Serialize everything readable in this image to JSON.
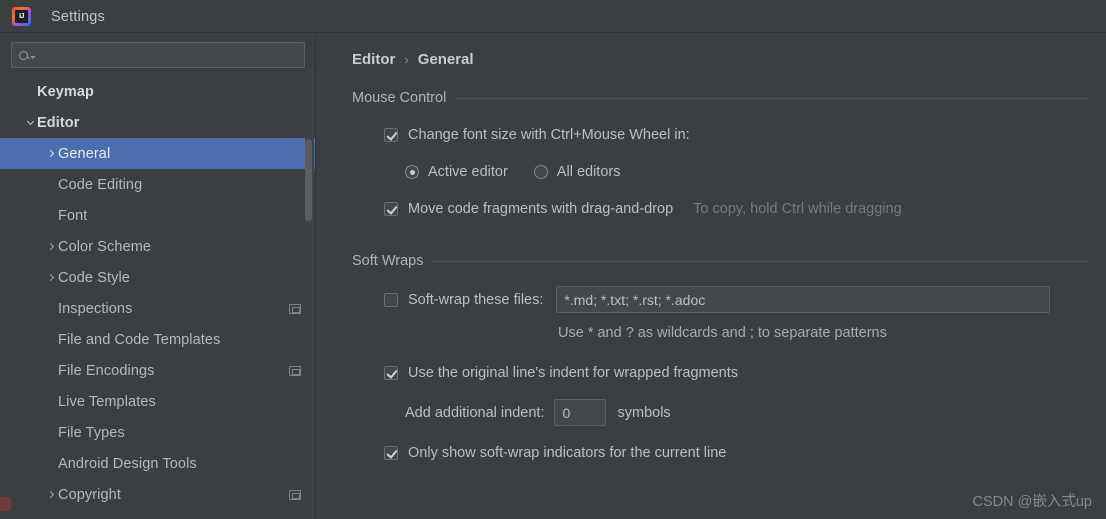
{
  "window": {
    "title": "Settings",
    "logo_icon": "intellij-idea-logo-icon"
  },
  "sidebar": {
    "search": {
      "placeholder": "",
      "value": "",
      "icon": "search-icon",
      "dropdown_icon": "chevron-down-icon"
    },
    "items": [
      {
        "label": "Keymap",
        "level": 0,
        "chevron": "none",
        "bold": true,
        "selected": false,
        "scope_icon": false
      },
      {
        "label": "Editor",
        "level": 0,
        "chevron": "down",
        "bold": true,
        "selected": false,
        "scope_icon": false
      },
      {
        "label": "General",
        "level": 1,
        "chevron": "right",
        "bold": false,
        "selected": true,
        "scope_icon": false
      },
      {
        "label": "Code Editing",
        "level": 1,
        "chevron": "none",
        "bold": false,
        "selected": false,
        "scope_icon": false
      },
      {
        "label": "Font",
        "level": 1,
        "chevron": "none",
        "bold": false,
        "selected": false,
        "scope_icon": false
      },
      {
        "label": "Color Scheme",
        "level": 1,
        "chevron": "right",
        "bold": false,
        "selected": false,
        "scope_icon": false
      },
      {
        "label": "Code Style",
        "level": 1,
        "chevron": "right",
        "bold": false,
        "selected": false,
        "scope_icon": false
      },
      {
        "label": "Inspections",
        "level": 1,
        "chevron": "none",
        "bold": false,
        "selected": false,
        "scope_icon": true
      },
      {
        "label": "File and Code Templates",
        "level": 1,
        "chevron": "none",
        "bold": false,
        "selected": false,
        "scope_icon": false
      },
      {
        "label": "File Encodings",
        "level": 1,
        "chevron": "none",
        "bold": false,
        "selected": false,
        "scope_icon": true
      },
      {
        "label": "Live Templates",
        "level": 1,
        "chevron": "none",
        "bold": false,
        "selected": false,
        "scope_icon": false
      },
      {
        "label": "File Types",
        "level": 1,
        "chevron": "none",
        "bold": false,
        "selected": false,
        "scope_icon": false
      },
      {
        "label": "Android Design Tools",
        "level": 1,
        "chevron": "none",
        "bold": false,
        "selected": false,
        "scope_icon": false
      },
      {
        "label": "Copyright",
        "level": 1,
        "chevron": "right",
        "bold": false,
        "selected": false,
        "scope_icon": true
      }
    ]
  },
  "main": {
    "breadcrumb": {
      "parent": "Editor",
      "separator": "›",
      "current": "General"
    },
    "sections": [
      {
        "title": "Mouse Control",
        "checkbox_font_size": {
          "label": "Change font size with Ctrl+Mouse Wheel in:",
          "checked": true
        },
        "radios": [
          {
            "label": "Active editor",
            "selected": true
          },
          {
            "label": "All editors",
            "selected": false
          }
        ],
        "checkbox_drag_drop": {
          "label": "Move code fragments with drag-and-drop",
          "checked": true,
          "hint": "To copy, hold Ctrl while dragging"
        }
      },
      {
        "title": "Soft Wraps",
        "checkbox_softwrap": {
          "label": "Soft-wrap these files:",
          "checked": false
        },
        "softwrap_files": {
          "value": "*.md; *.txt; *.rst; *.adoc",
          "placeholder": ""
        },
        "wildcard_hint": "Use * and ? as wildcards and ; to separate patterns",
        "checkbox_indent": {
          "label": "Use the original line's indent for wrapped fragments",
          "checked": true
        },
        "additional_indent": {
          "label": "Add additional indent:",
          "value": "0",
          "unit": "symbols"
        },
        "checkbox_indicators": {
          "label": "Only show soft-wrap indicators for the current line",
          "checked": true
        }
      }
    ]
  },
  "watermark": {
    "text": "CSDN @嵌入式up"
  },
  "colors": {
    "background": "#3c3f41",
    "selection": "#4b6eaf",
    "text": "#bcbec0",
    "muted_text": "#76797b",
    "field_background": "#45484a",
    "border": "#5c5f61"
  }
}
